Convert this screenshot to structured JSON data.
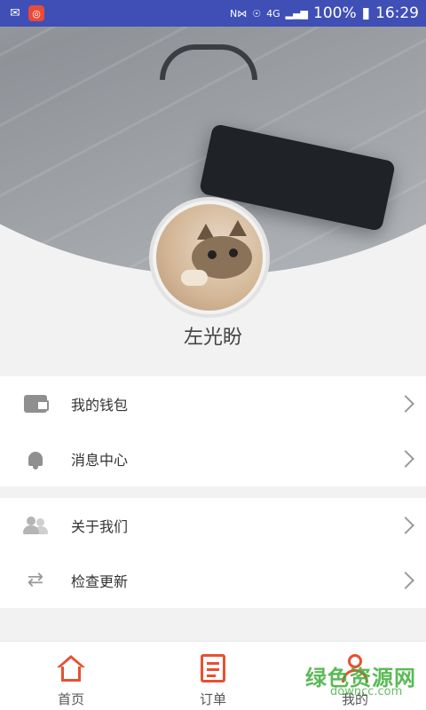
{
  "status_bar": {
    "battery": "100%",
    "time": "16:29",
    "network": "4G"
  },
  "profile": {
    "name": "左光盼"
  },
  "menu": {
    "group1": [
      {
        "label": "我的钱包",
        "icon": "wallet-icon"
      },
      {
        "label": "消息中心",
        "icon": "bell-icon"
      }
    ],
    "group2": [
      {
        "label": "关于我们",
        "icon": "people-icon"
      },
      {
        "label": "检查更新",
        "icon": "refresh-icon"
      }
    ]
  },
  "tabbar": {
    "tabs": [
      {
        "label": "首页",
        "icon": "home-icon"
      },
      {
        "label": "订单",
        "icon": "order-icon"
      },
      {
        "label": "我的",
        "icon": "user-icon"
      }
    ]
  },
  "watermark": {
    "text": "绿色资源网",
    "url": "downcc.com"
  },
  "colors": {
    "status_bar": "#3f4fb5",
    "accent": "#e8502f",
    "background": "#f2f2f2"
  }
}
